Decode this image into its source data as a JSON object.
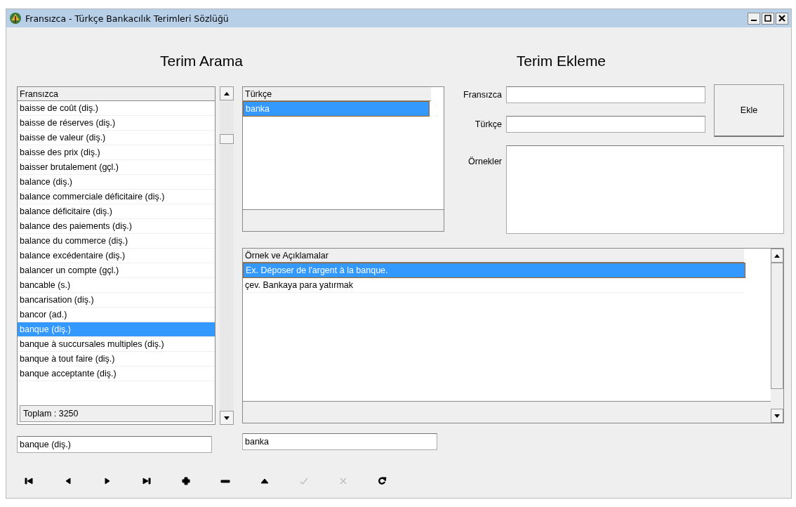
{
  "window": {
    "title": "Fransızca - Türkçe Bankacılık Terimleri Sözlüğü"
  },
  "search_heading": "Terim Arama",
  "add_heading": "Terim Ekleme",
  "term_list": {
    "column": "Fransızca",
    "total": "Toplam : 3250",
    "rows": [
      {
        "text": "baisse de coût (diş.)",
        "selected": false
      },
      {
        "text": "baisse de réserves (diş.)",
        "selected": false
      },
      {
        "text": "baisse de valeur (diş.)",
        "selected": false
      },
      {
        "text": "baisse des prix (diş.)",
        "selected": false
      },
      {
        "text": "baisser brutalement (gçl.)",
        "selected": false
      },
      {
        "text": "balance (diş.)",
        "selected": false
      },
      {
        "text": "balance commerciale déficitaire (diş.)",
        "selected": false
      },
      {
        "text": "balance déficitaire (diş.)",
        "selected": false
      },
      {
        "text": "balance des paiements (diş.)",
        "selected": false
      },
      {
        "text": "balance du commerce (diş.)",
        "selected": false
      },
      {
        "text": "balance excédentaire (diş.)",
        "selected": false
      },
      {
        "text": "balancer un compte (gçl.)",
        "selected": false
      },
      {
        "text": "bancable (s.)",
        "selected": false
      },
      {
        "text": "bancarisation (diş.)",
        "selected": false
      },
      {
        "text": "bancor (ad.)",
        "selected": false
      },
      {
        "text": "banque (diş.)",
        "selected": true
      },
      {
        "text": "banque à succursales multiples (diş.)",
        "selected": false
      },
      {
        "text": "banque à tout faire (diş.)",
        "selected": false
      },
      {
        "text": "banque acceptante (diş.)",
        "selected": false
      }
    ]
  },
  "translation_list": {
    "column": "Türkçe",
    "rows": [
      {
        "text": "banka",
        "selected": true
      }
    ]
  },
  "add_form": {
    "fields": [
      {
        "label": "Fransızca"
      },
      {
        "label": "Türkçe"
      }
    ],
    "examples_label": "Örnekler",
    "button": "Ekle"
  },
  "examples_grid": {
    "column": "Örnek ve Açıklamalar",
    "rows": [
      {
        "text": "Ex. Déposer de l'argent à la banque.",
        "selected": true
      },
      {
        "text": "çev. Bankaya para yatırmak",
        "selected": false
      }
    ]
  },
  "term_field": {
    "value": "banque (diş.)"
  },
  "translation_field": {
    "value": "banka"
  },
  "navigator": [
    {
      "kind": "first",
      "disabled": false
    },
    {
      "kind": "prior",
      "disabled": false
    },
    {
      "kind": "next",
      "disabled": false
    },
    {
      "kind": "last",
      "disabled": false
    },
    {
      "kind": "insert",
      "disabled": false
    },
    {
      "kind": "delete",
      "disabled": false
    },
    {
      "kind": "edit",
      "disabled": false
    },
    {
      "kind": "post",
      "disabled": true
    },
    {
      "kind": "cancel",
      "disabled": true
    },
    {
      "kind": "refresh",
      "disabled": false
    }
  ]
}
